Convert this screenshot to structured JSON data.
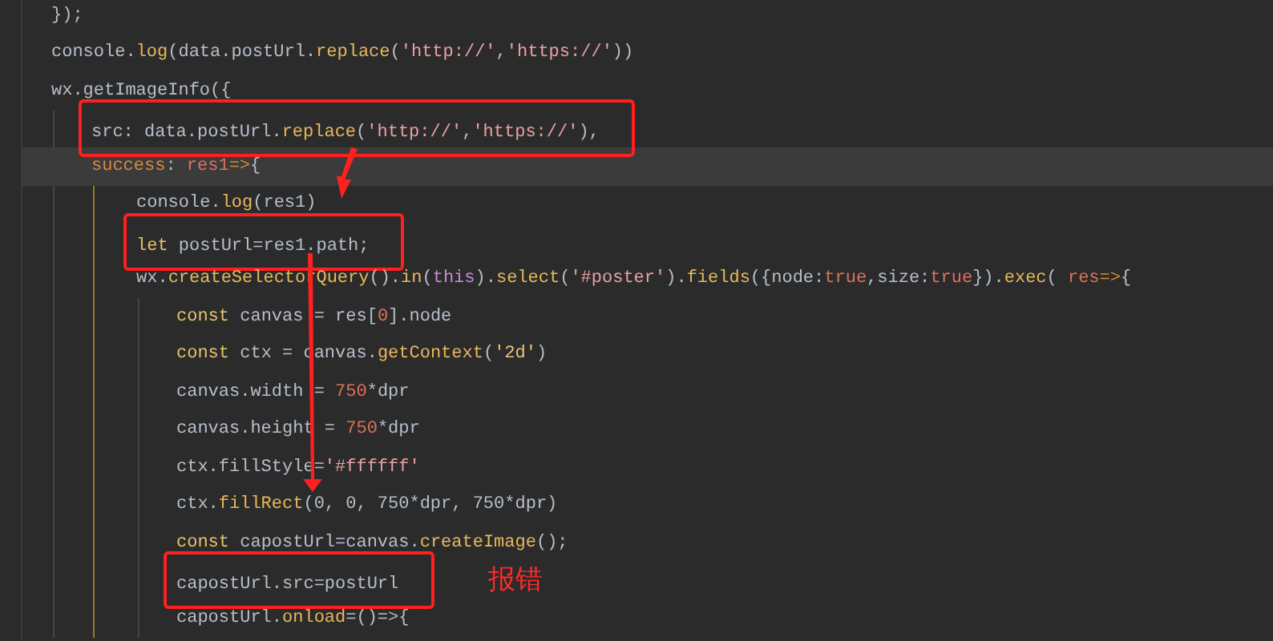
{
  "editor": {
    "lines": [
      {
        "tokens": [
          {
            "kind": "plain",
            "text": "});"
          }
        ]
      },
      {
        "tokens": [
          {
            "kind": "plain",
            "text": "console."
          },
          {
            "kind": "fn",
            "text": "log"
          },
          {
            "kind": "plain",
            "text": "(data.postUrl."
          },
          {
            "kind": "fn",
            "text": "replace"
          },
          {
            "kind": "plain",
            "text": "("
          },
          {
            "kind": "str",
            "text": "'http://'"
          },
          {
            "kind": "plain",
            "text": ","
          },
          {
            "kind": "str",
            "text": "'https://'"
          },
          {
            "kind": "plain",
            "text": "))"
          }
        ]
      },
      {
        "tokens": [
          {
            "kind": "plain",
            "text": "wx.getImageInfo({"
          }
        ],
        "children": [
          {
            "tokens": [
              {
                "kind": "plain",
                "text": "src: data.postUrl."
              },
              {
                "kind": "fn",
                "text": "replace"
              },
              {
                "kind": "plain",
                "text": "("
              },
              {
                "kind": "str",
                "text": "'http://'"
              },
              {
                "kind": "plain",
                "text": ","
              },
              {
                "kind": "str",
                "text": "'https://'"
              },
              {
                "kind": "plain",
                "text": "),"
              }
            ],
            "boxed": true
          },
          {
            "tokens": [
              {
                "kind": "key",
                "text": "success"
              },
              {
                "kind": "plain",
                "text": ": "
              },
              {
                "kind": "param",
                "text": "res1"
              },
              {
                "kind": "key",
                "text": "=>"
              },
              {
                "kind": "plain",
                "text": "{"
              }
            ],
            "current": true,
            "children": [
              {
                "tokens": [
                  {
                    "kind": "plain",
                    "text": "console."
                  },
                  {
                    "kind": "fn",
                    "text": "log"
                  },
                  {
                    "kind": "plain",
                    "text": "(res1)"
                  }
                ]
              },
              {
                "tokens": [
                  {
                    "kind": "kw",
                    "text": "let"
                  },
                  {
                    "kind": "plain",
                    "text": " postUrl=res1.path;"
                  }
                ],
                "boxed": true
              },
              {
                "tokens": [
                  {
                    "kind": "plain",
                    "text": "wx."
                  },
                  {
                    "kind": "fn",
                    "text": "createSelectorQuery"
                  },
                  {
                    "kind": "plain",
                    "text": "()."
                  },
                  {
                    "kind": "fn",
                    "text": "in"
                  },
                  {
                    "kind": "plain",
                    "text": "("
                  },
                  {
                    "kind": "this",
                    "text": "this"
                  },
                  {
                    "kind": "plain",
                    "text": ")."
                  },
                  {
                    "kind": "fn",
                    "text": "select"
                  },
                  {
                    "kind": "plain",
                    "text": "("
                  },
                  {
                    "kind": "str",
                    "text": "'#poster'"
                  },
                  {
                    "kind": "plain",
                    "text": ")."
                  },
                  {
                    "kind": "fn",
                    "text": "fields"
                  },
                  {
                    "kind": "plain",
                    "text": "({node:"
                  },
                  {
                    "kind": "num",
                    "text": "true"
                  },
                  {
                    "kind": "plain",
                    "text": ",size:"
                  },
                  {
                    "kind": "num",
                    "text": "true"
                  },
                  {
                    "kind": "plain",
                    "text": "})."
                  },
                  {
                    "kind": "fn",
                    "text": "exec"
                  },
                  {
                    "kind": "plain",
                    "text": "( "
                  },
                  {
                    "kind": "param",
                    "text": "res"
                  },
                  {
                    "kind": "key",
                    "text": "=>"
                  },
                  {
                    "kind": "plain",
                    "text": "{"
                  }
                ],
                "children": [
                  {
                    "tokens": [
                      {
                        "kind": "kw",
                        "text": "const"
                      },
                      {
                        "kind": "plain",
                        "text": " canvas = res["
                      },
                      {
                        "kind": "num",
                        "text": "0"
                      },
                      {
                        "kind": "plain",
                        "text": "].node"
                      }
                    ]
                  },
                  {
                    "tokens": [
                      {
                        "kind": "kw",
                        "text": "const"
                      },
                      {
                        "kind": "plain",
                        "text": " ctx = canvas."
                      },
                      {
                        "kind": "fn",
                        "text": "getContext"
                      },
                      {
                        "kind": "plain",
                        "text": "("
                      },
                      {
                        "kind": "str2",
                        "text": "'2d'"
                      },
                      {
                        "kind": "plain",
                        "text": ")"
                      }
                    ]
                  },
                  {
                    "tokens": [
                      {
                        "kind": "plain",
                        "text": "canvas.width = "
                      },
                      {
                        "kind": "num",
                        "text": "750"
                      },
                      {
                        "kind": "plain",
                        "text": "*dpr"
                      }
                    ]
                  },
                  {
                    "tokens": [
                      {
                        "kind": "plain",
                        "text": "canvas.height = "
                      },
                      {
                        "kind": "num",
                        "text": "750"
                      },
                      {
                        "kind": "plain",
                        "text": "*dpr"
                      }
                    ]
                  },
                  {
                    "tokens": [
                      {
                        "kind": "plain",
                        "text": "ctx.fillStyle="
                      },
                      {
                        "kind": "str",
                        "text": "'#ffffff'"
                      }
                    ]
                  },
                  {
                    "tokens": [
                      {
                        "kind": "plain",
                        "text": "ctx."
                      },
                      {
                        "kind": "fn",
                        "text": "fillRect"
                      },
                      {
                        "kind": "plain",
                        "text": "(0, 0, 750*dpr, 750*dpr)"
                      }
                    ]
                  },
                  {
                    "tokens": [
                      {
                        "kind": "kw",
                        "text": "const"
                      },
                      {
                        "kind": "plain",
                        "text": " capostUrl=canvas."
                      },
                      {
                        "kind": "fn",
                        "text": "createImage"
                      },
                      {
                        "kind": "plain",
                        "text": "();"
                      }
                    ]
                  },
                  {
                    "tokens": [
                      {
                        "kind": "plain",
                        "text": "capostUrl.src=postUrl"
                      }
                    ],
                    "boxed": true,
                    "note": "报错"
                  },
                  {
                    "tokens": [
                      {
                        "kind": "plain",
                        "text": "capostUrl."
                      },
                      {
                        "kind": "fn",
                        "text": "onload"
                      },
                      {
                        "kind": "plain",
                        "text": "=()=>{"
                      }
                    ]
                  }
                ]
              }
            ]
          }
        ]
      }
    ]
  }
}
